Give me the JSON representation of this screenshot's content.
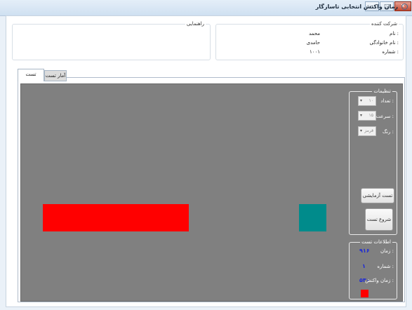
{
  "window": {
    "title": "زمان واکنش انتخابی  تاسازگار",
    "controls": {
      "minimize": "–",
      "maximize": "□",
      "close": "✕"
    }
  },
  "provider": {
    "title": "شرکت کننده",
    "name_label": "نام :",
    "name_value": "محمد",
    "family_label": "نام خانوادگی :",
    "family_value": "حامدی",
    "number_label": "شماره :",
    "number_value": "۱۰۰۱"
  },
  "guide": {
    "title": "راهنمایی"
  },
  "tabs": [
    {
      "label": "تست"
    },
    {
      "label": "آمار تست"
    }
  ],
  "settings": {
    "title": "تنظیمات",
    "count_label": "تعداد :",
    "count_value": "۱۰",
    "speed_label": "سرعت :",
    "speed_value": "۱۵",
    "color_label": "رنگ :",
    "color_value": "قرمز",
    "trial_button": "تست آزمایشی",
    "start_button": "شروع تست"
  },
  "test_info": {
    "title": "اطلاعات تست",
    "time_label": "زمان :",
    "time_value": "۹۱۶",
    "number_label": "شماره :",
    "number_value": "۱",
    "reaction_label": "زمان واکنش :",
    "reaction_value": "۵۳۰",
    "indicator_color": "#ff0000"
  },
  "stimuli": {
    "bar_color": "#ff0000",
    "square_color": "#008b8b",
    "canvas_color": "#808080"
  }
}
